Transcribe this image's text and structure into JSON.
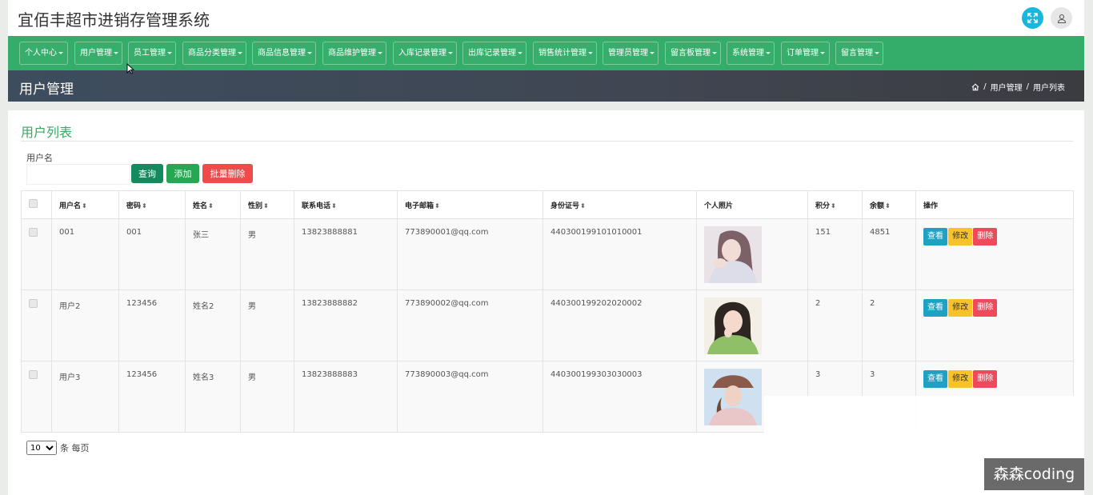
{
  "app": {
    "title": "宜佰丰超市进销存管理系统"
  },
  "nav": {
    "items": [
      {
        "label": "个人中心"
      },
      {
        "label": "用户管理"
      },
      {
        "label": "员工管理"
      },
      {
        "label": "商品分类管理"
      },
      {
        "label": "商品信息管理"
      },
      {
        "label": "商品维护管理"
      },
      {
        "label": "入库记录管理"
      },
      {
        "label": "出库记录管理"
      },
      {
        "label": "销售统计管理"
      },
      {
        "label": "管理员管理"
      },
      {
        "label": "留言板管理"
      },
      {
        "label": "系统管理"
      },
      {
        "label": "订单管理"
      },
      {
        "label": "留言管理"
      }
    ]
  },
  "header": {
    "page_title": "用户管理",
    "breadcrumb": [
      "用户管理",
      "用户列表"
    ]
  },
  "card": {
    "title": "用户列表"
  },
  "search": {
    "label": "用户名",
    "value": "",
    "placeholder": "",
    "query_label": "查询",
    "add_label": "添加",
    "bulk_delete_label": "批量删除"
  },
  "table": {
    "columns": [
      "用户名",
      "密码",
      "姓名",
      "性别",
      "联系电话",
      "电子邮箱",
      "身份证号",
      "个人照片",
      "积分",
      "余额",
      "操作"
    ],
    "rows": [
      {
        "username": "001",
        "password": "001",
        "name": "张三",
        "gender": "男",
        "phone": "13823888881",
        "email": "773890001@qq.com",
        "id_number": "440300199101010001",
        "points": "151",
        "balance": "4851"
      },
      {
        "username": "用户2",
        "password": "123456",
        "name": "姓名2",
        "gender": "男",
        "phone": "13823888882",
        "email": "773890002@qq.com",
        "id_number": "440300199202020002",
        "points": "2",
        "balance": "2"
      },
      {
        "username": "用户3",
        "password": "123456",
        "name": "姓名3",
        "gender": "男",
        "phone": "13823888883",
        "email": "773890003@qq.com",
        "id_number": "440300199303030003",
        "points": "3",
        "balance": "3"
      }
    ],
    "actions": {
      "view": "查看",
      "edit": "修改",
      "delete": "删除"
    }
  },
  "pagination": {
    "page_size": "10",
    "suffix": "条 每页"
  },
  "watermark": "森森coding",
  "colors": {
    "nav_green": "#35ad6a",
    "title_green": "#3aa862",
    "view_blue": "#1fa2c2",
    "edit_yellow": "#f7c22a",
    "delete_red": "#ee4a5c"
  }
}
